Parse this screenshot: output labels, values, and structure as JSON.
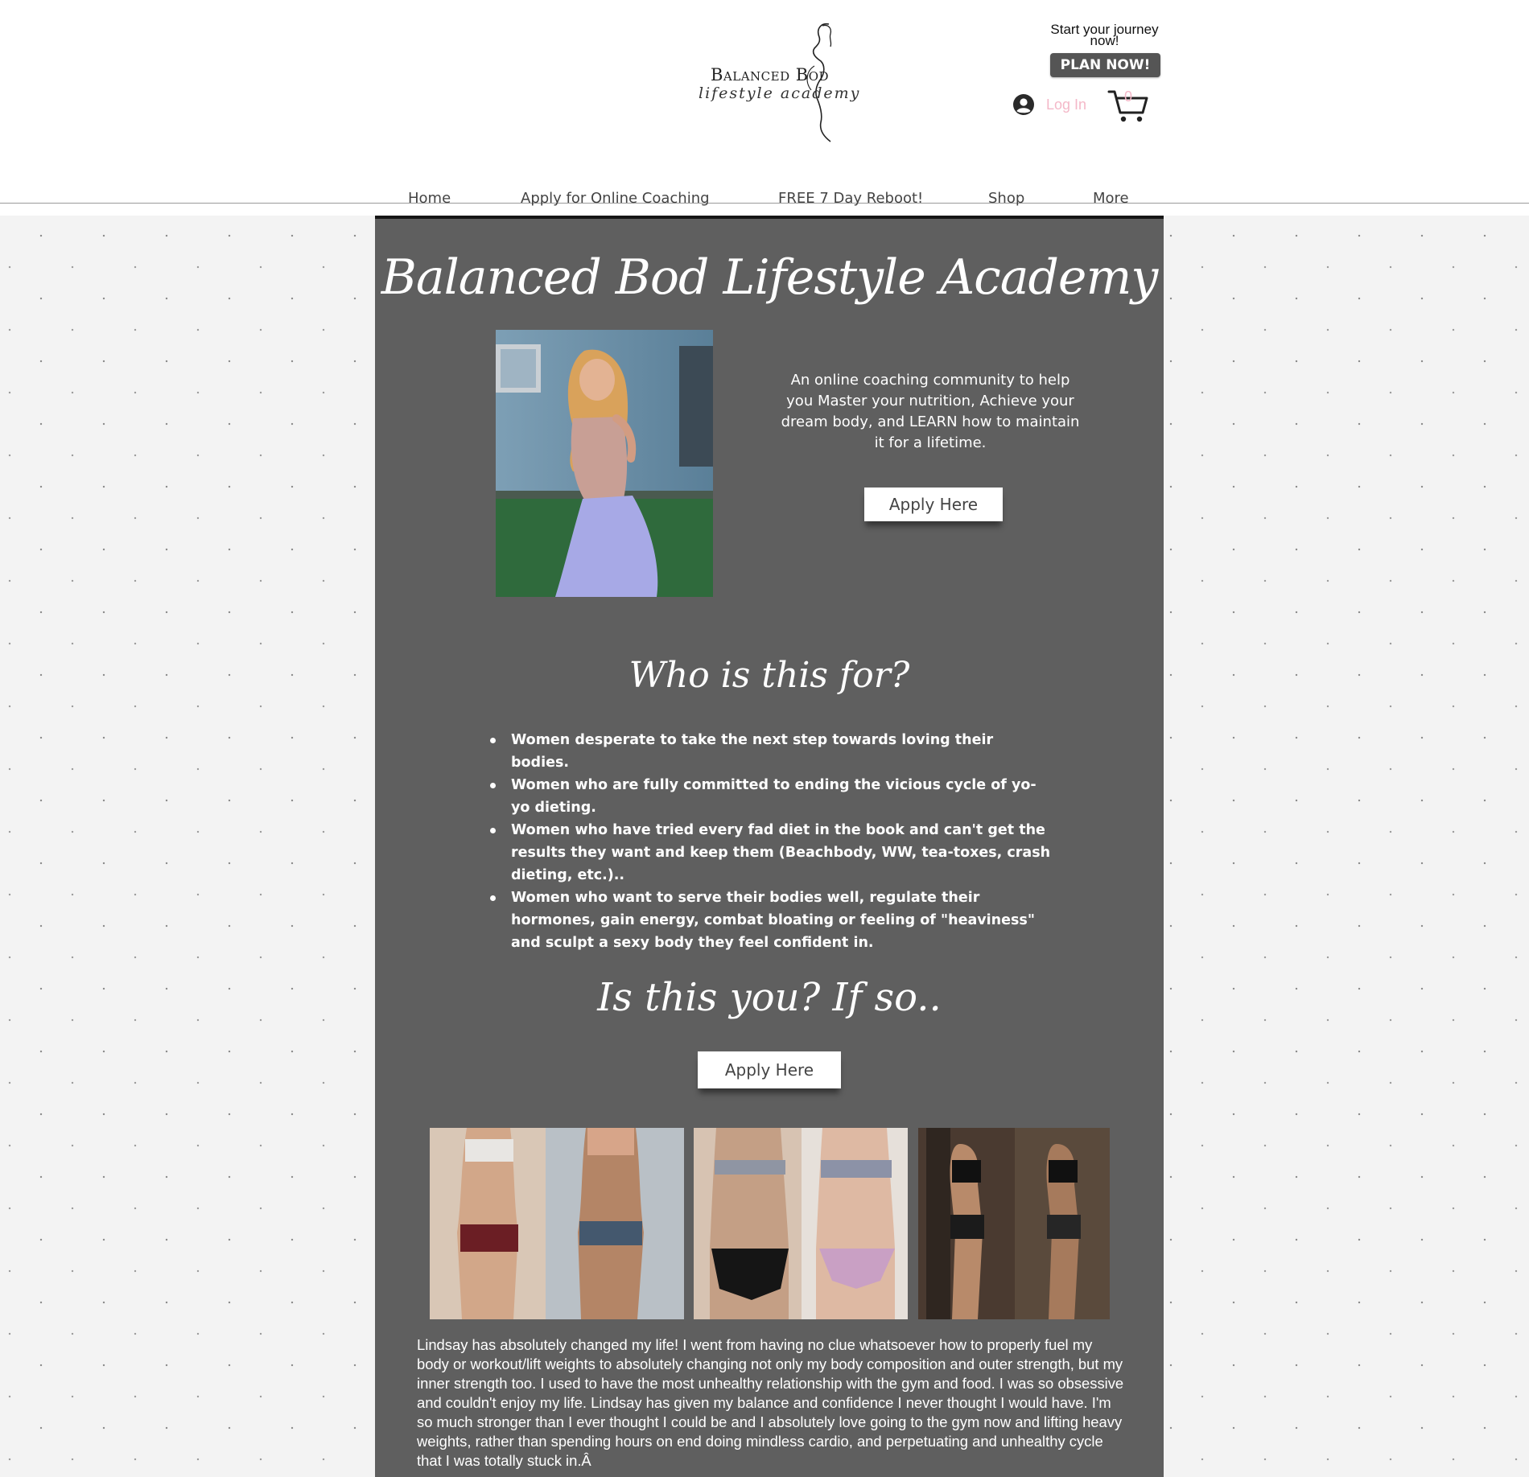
{
  "header": {
    "logo": {
      "brand": "Balanced Bod",
      "tagline": "lifestyle academy"
    },
    "promo": {
      "line1": "Start your journey",
      "line2": "now!",
      "button": "PLAN NOW!"
    },
    "login": {
      "label": "Log In",
      "icon": "user-avatar-icon"
    },
    "cart": {
      "count": "0",
      "icon": "cart-icon"
    }
  },
  "nav": {
    "items": [
      "Home",
      "Apply for Online Coaching",
      "FREE 7 Day Reboot!",
      "Shop",
      "More"
    ]
  },
  "main": {
    "title": "Balanced Bod Lifestyle Academy",
    "intro": "An online coaching community to help you Master your nutrition, Achieve your dream body, and LEARN how to maintain it for a lifetime.",
    "apply_button_1": "Apply Here",
    "who_heading": "Who is this for?",
    "bullets": [
      "Women desperate to take the next step towards loving their bodies.",
      "Women who are fully committed to ending the vicious cycle of yo-yo dieting.",
      "Women who have tried every fad diet in the book and can't get the results  they want and keep them (Beachbody, WW, tea-toxes, crash dieting, etc.)..",
      "Women who want to serve their bodies well, regulate their hormones, gain energy, combat bloating or feeling of \"heaviness\" and sculpt a sexy body they feel confident in."
    ],
    "isyou_heading": "Is this you? If so..",
    "apply_button_2": "Apply Here",
    "testimonial": "Lindsay has absolutely changed my life! I went from having no clue whatsoever how to properly fuel my body or workout/lift weights to absolutely changing not only my body composition and outer strength, but my inner strength too. I used to have the most unhealthy relationship with the gym and food. I was so obsessive and couldn't enjoy my life. Lindsay has given my balance and confidence I never thought I would have. I'm so much stronger than I ever thought I could be and I absolutely love going to the gym now and lifting heavy weights, rather than spending hours on end doing mindless cardio, and perpetuating and unhealthy cycle that I was totally stuck in.Â"
  },
  "colors": {
    "content_bg": "#5f5f5f",
    "page_bg": "#f3f3f3",
    "accent_pink": "#f4b8c8",
    "button_dark": "#555555"
  }
}
